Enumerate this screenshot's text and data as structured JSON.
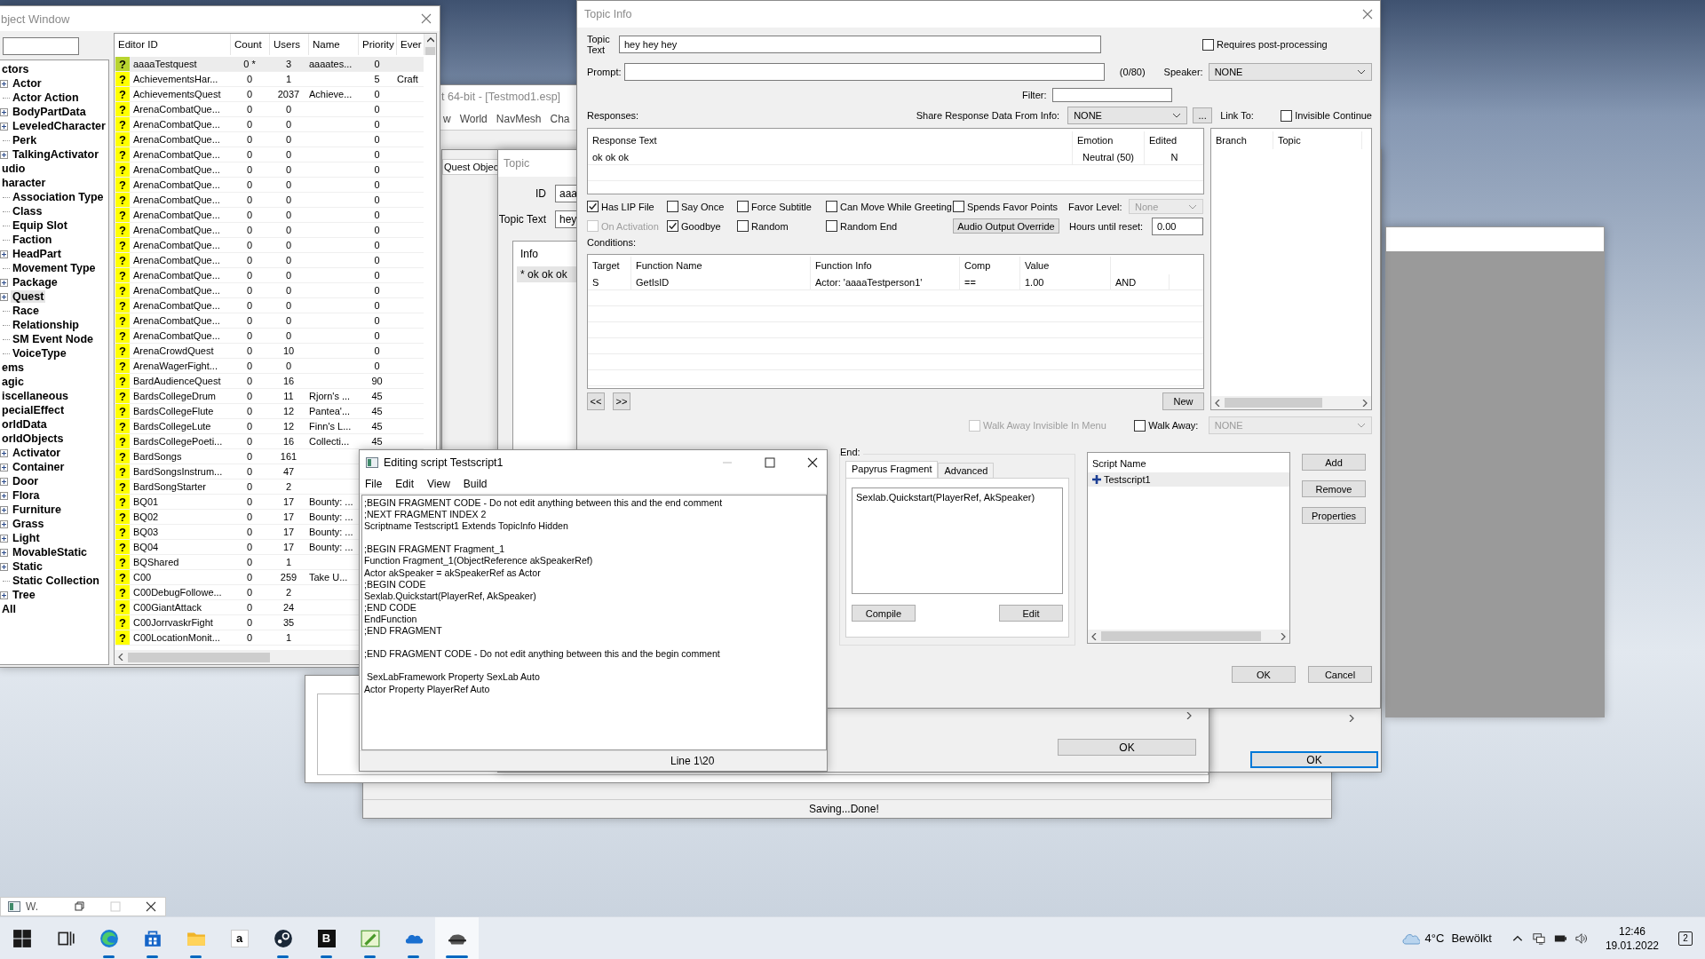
{
  "main_window": {
    "title": "t 64-bit - [Testmod1.esp]",
    "menu": [
      "w",
      "World",
      "NavMesh",
      "Cha"
    ],
    "status": "Saving...Done!"
  },
  "quest_window": {
    "tab": "Quest Objec",
    "ok": "OK"
  },
  "topic_window": {
    "title": "Topic",
    "id_label": "ID",
    "id_value": "aaa",
    "text_label": "Topic Text",
    "text_value": "hey",
    "info_header": "Info",
    "info_items": [
      {
        "text": "* ok ok ok",
        "selected": true
      }
    ],
    "ok": "OK"
  },
  "object_window": {
    "title": "bject Window",
    "tree": [
      {
        "label": "ctors",
        "selected": false,
        "children": [
          {
            "label": "Actor",
            "expander": true,
            "selected": false
          },
          {
            "label": "Actor Action",
            "expander": false,
            "selected": false
          },
          {
            "label": "BodyPartData",
            "expander": true,
            "selected": false
          },
          {
            "label": "LeveledCharacter",
            "expander": true,
            "selected": false
          },
          {
            "label": "Perk",
            "expander": false,
            "selected": false
          },
          {
            "label": "TalkingActivator",
            "expander": true,
            "selected": false
          }
        ]
      },
      {
        "label": "udio",
        "selected": false
      },
      {
        "label": "haracter",
        "selected": false,
        "children": [
          {
            "label": "Association Type",
            "expander": false,
            "selected": false
          },
          {
            "label": "Class",
            "expander": false,
            "selected": false
          },
          {
            "label": "Equip Slot",
            "expander": false,
            "selected": false
          },
          {
            "label": "Faction",
            "expander": false,
            "selected": false
          },
          {
            "label": "HeadPart",
            "expander": true,
            "selected": false
          },
          {
            "label": "Movement Type",
            "expander": false,
            "selected": false
          },
          {
            "label": "Package",
            "expander": true,
            "selected": false
          },
          {
            "label": "Quest",
            "expander": true,
            "selected": true
          },
          {
            "label": "Race",
            "expander": false,
            "selected": false
          },
          {
            "label": "Relationship",
            "expander": false,
            "selected": false
          },
          {
            "label": "SM Event Node",
            "expander": false,
            "selected": false
          },
          {
            "label": "VoiceType",
            "expander": false,
            "selected": false
          }
        ]
      },
      {
        "label": "ems",
        "selected": false
      },
      {
        "label": "agic",
        "selected": false
      },
      {
        "label": "iscellaneous",
        "selected": false
      },
      {
        "label": "pecialEffect",
        "selected": false
      },
      {
        "label": "orldData",
        "selected": false
      },
      {
        "label": "orldObjects",
        "selected": false,
        "children": [
          {
            "label": "Activator",
            "expander": true,
            "selected": false
          },
          {
            "label": "Container",
            "expander": true,
            "selected": false
          },
          {
            "label": "Door",
            "expander": true,
            "selected": false
          },
          {
            "label": "Flora",
            "expander": true,
            "selected": false
          },
          {
            "label": "Furniture",
            "expander": true,
            "selected": false
          },
          {
            "label": "Grass",
            "expander": true,
            "selected": false
          },
          {
            "label": "Light",
            "expander": true,
            "selected": false
          },
          {
            "label": "MovableStatic",
            "expander": true,
            "selected": false
          },
          {
            "label": "Static",
            "expander": true,
            "selected": false
          },
          {
            "label": "Static Collection",
            "expander": false,
            "selected": false
          },
          {
            "label": "Tree",
            "expander": true,
            "selected": false
          }
        ]
      },
      {
        "label": "All",
        "selected": false
      }
    ],
    "columns": [
      "Editor ID",
      "Count",
      "Users",
      "Name",
      "Priority",
      "Ever"
    ],
    "rows": [
      {
        "icon": "?",
        "editor_id": "aaaaTestquest",
        "count": "0 *",
        "users": "3",
        "name": "aaaates...",
        "priority": "0",
        "selected": true
      },
      {
        "icon": "?",
        "editor_id": "AchievementsHar...",
        "count": "0",
        "users": "1",
        "priority": "5",
        "ever": "Craft",
        "selected": false
      },
      {
        "icon": "?",
        "editor_id": "AchievementsQuest",
        "count": "0",
        "users": "2037",
        "name": "Achieve...",
        "priority": "0",
        "selected": false
      },
      {
        "icon": "?",
        "editor_id": "ArenaCombatQue...",
        "count": "0",
        "users": "0",
        "priority": "0",
        "selected": false
      },
      {
        "icon": "?",
        "editor_id": "ArenaCombatQue...",
        "count": "0",
        "users": "0",
        "priority": "0",
        "selected": false
      },
      {
        "icon": "?",
        "editor_id": "ArenaCombatQue...",
        "count": "0",
        "users": "0",
        "priority": "0",
        "selected": false
      },
      {
        "icon": "?",
        "editor_id": "ArenaCombatQue...",
        "count": "0",
        "users": "0",
        "priority": "0",
        "selected": false
      },
      {
        "icon": "?",
        "editor_id": "ArenaCombatQue...",
        "count": "0",
        "users": "0",
        "priority": "0",
        "selected": false
      },
      {
        "icon": "?",
        "editor_id": "ArenaCombatQue...",
        "count": "0",
        "users": "0",
        "priority": "0",
        "selected": false
      },
      {
        "icon": "?",
        "editor_id": "ArenaCombatQue...",
        "count": "0",
        "users": "0",
        "priority": "0",
        "selected": false
      },
      {
        "icon": "?",
        "editor_id": "ArenaCombatQue...",
        "count": "0",
        "users": "0",
        "priority": "0",
        "selected": false
      },
      {
        "icon": "?",
        "editor_id": "ArenaCombatQue...",
        "count": "0",
        "users": "0",
        "priority": "0",
        "selected": false
      },
      {
        "icon": "?",
        "editor_id": "ArenaCombatQue...",
        "count": "0",
        "users": "0",
        "priority": "0",
        "selected": false
      },
      {
        "icon": "?",
        "editor_id": "ArenaCombatQue...",
        "count": "0",
        "users": "0",
        "priority": "0",
        "selected": false
      },
      {
        "icon": "?",
        "editor_id": "ArenaCombatQue...",
        "count": "0",
        "users": "0",
        "priority": "0",
        "selected": false
      },
      {
        "icon": "?",
        "editor_id": "ArenaCombatQue...",
        "count": "0",
        "users": "0",
        "priority": "0",
        "selected": false
      },
      {
        "icon": "?",
        "editor_id": "ArenaCombatQue...",
        "count": "0",
        "users": "0",
        "priority": "0",
        "selected": false
      },
      {
        "icon": "?",
        "editor_id": "ArenaCombatQue...",
        "count": "0",
        "users": "0",
        "priority": "0",
        "selected": false
      },
      {
        "icon": "?",
        "editor_id": "ArenaCombatQue...",
        "count": "0",
        "users": "0",
        "priority": "0",
        "selected": false
      },
      {
        "icon": "?",
        "editor_id": "ArenaCrowdQuest",
        "count": "0",
        "users": "10",
        "priority": "0",
        "selected": false
      },
      {
        "icon": "?",
        "editor_id": "ArenaWagerFight...",
        "count": "0",
        "users": "0",
        "priority": "0",
        "selected": false
      },
      {
        "icon": "?",
        "editor_id": "BardAudienceQuest",
        "count": "0",
        "users": "16",
        "priority": "90",
        "selected": false
      },
      {
        "icon": "?",
        "editor_id": "BardsCollegeDrum",
        "count": "0",
        "users": "11",
        "name": "Rjorn's ...",
        "priority": "45",
        "selected": false
      },
      {
        "icon": "?",
        "editor_id": "BardsCollegeFlute",
        "count": "0",
        "users": "12",
        "name": "Pantea'...",
        "priority": "45",
        "selected": false
      },
      {
        "icon": "?",
        "editor_id": "BardsCollegeLute",
        "count": "0",
        "users": "12",
        "name": "Finn's L...",
        "priority": "45",
        "selected": false
      },
      {
        "icon": "?",
        "editor_id": "BardsCollegePoeti...",
        "count": "0",
        "users": "16",
        "name": "Collecti...",
        "priority": "45",
        "selected": false
      },
      {
        "icon": "?",
        "editor_id": "BardSongs",
        "count": "0",
        "users": "161",
        "selected": false
      },
      {
        "icon": "?",
        "editor_id": "BardSongsInstrum...",
        "count": "0",
        "users": "47",
        "selected": false
      },
      {
        "icon": "?",
        "editor_id": "BardSongStarter",
        "count": "0",
        "users": "2",
        "selected": false
      },
      {
        "icon": "?",
        "editor_id": "BQ01",
        "count": "0",
        "users": "17",
        "name": "Bounty: ...",
        "selected": false
      },
      {
        "icon": "?",
        "editor_id": "BQ02",
        "count": "0",
        "users": "17",
        "name": "Bounty: ...",
        "selected": false
      },
      {
        "icon": "?",
        "editor_id": "BQ03",
        "count": "0",
        "users": "17",
        "name": "Bounty: ...",
        "selected": false
      },
      {
        "icon": "?",
        "editor_id": "BQ04",
        "count": "0",
        "users": "17",
        "name": "Bounty: ...",
        "selected": false
      },
      {
        "icon": "?",
        "editor_id": "BQShared",
        "count": "0",
        "users": "1",
        "selected": false
      },
      {
        "icon": "?",
        "editor_id": "C00",
        "count": "0",
        "users": "259",
        "name": "Take U...",
        "selected": false
      },
      {
        "icon": "?",
        "editor_id": "C00DebugFollowe...",
        "count": "0",
        "users": "2",
        "selected": false
      },
      {
        "icon": "?",
        "editor_id": "C00GiantAttack",
        "count": "0",
        "users": "24",
        "selected": false
      },
      {
        "icon": "?",
        "editor_id": "C00JorrvaskrFight",
        "count": "0",
        "users": "35",
        "selected": false
      },
      {
        "icon": "?",
        "editor_id": "C00LocationMonit...",
        "count": "0",
        "users": "1",
        "selected": false
      }
    ]
  },
  "topic_info": {
    "title": "Topic Info",
    "topic_text_label": "Topic Text",
    "topic_text": "hey hey hey",
    "requires_post_processing": {
      "label": "Requires post-processing",
      "checked": false
    },
    "prompt_label": "Prompt:",
    "prompt_count": "(0/80)",
    "speaker_label": "Speaker:",
    "speaker": {
      "value": "NONE",
      "disabled": false
    },
    "filter_label": "Filter:",
    "responses_label": "Responses:",
    "share_label": "Share Response Data From Info:",
    "share_value": {
      "value": "NONE",
      "disabled": false
    },
    "more_button": "...",
    "link_to_label": "Link To:",
    "invisible_continue": {
      "label": "Invisible Continue",
      "checked": false
    },
    "response_columns": [
      "Response Text",
      "Emotion",
      "Edited"
    ],
    "response_rows": [
      [
        "ok ok ok",
        "Neutral (50)",
        "N"
      ]
    ],
    "link_columns": [
      "Branch",
      "Topic"
    ],
    "flags_row1": [
      {
        "label": "Has LIP File",
        "checked": true,
        "disabled": false
      },
      {
        "label": "Say Once",
        "checked": false,
        "disabled": false
      },
      {
        "label": "Force Subtitle",
        "checked": false,
        "disabled": false
      },
      {
        "label": "Can Move While Greeting",
        "checked": false,
        "disabled": false
      },
      {
        "label": "Spends Favor Points",
        "checked": false,
        "disabled": false
      }
    ],
    "flags_row2": [
      {
        "label": "On Activation",
        "checked": false,
        "disabled": true
      },
      {
        "label": "Goodbye",
        "checked": true,
        "disabled": false
      },
      {
        "label": "Random",
        "checked": false,
        "disabled": false
      },
      {
        "label": "Random End",
        "checked": false,
        "disabled": false
      }
    ],
    "favor_label": "Favor Level:",
    "favor": {
      "value": "None",
      "disabled": true
    },
    "audio_button": "Audio Output Override",
    "hours_label": "Hours until reset:",
    "hours_value": "0.00",
    "conditions_label": "Conditions:",
    "condition_columns": [
      "Target",
      "Function Name",
      "Function Info",
      "Comp",
      "Value"
    ],
    "condition_rows": [
      [
        "S",
        "GetIsID",
        "Actor: 'aaaaTestperson1'",
        "==",
        "1.00",
        "AND"
      ]
    ],
    "prev_button": "<<",
    "next_button": ">>",
    "new_button": "New",
    "walk_away_invisible": {
      "label": "Walk Away Invisible In Menu",
      "checked": false,
      "disabled": true
    },
    "walk_away": {
      "label": "Walk Away:",
      "checked": false,
      "disabled": false
    },
    "walk_away_value": {
      "value": "NONE",
      "disabled": true
    },
    "end_label": "End:",
    "tabs": [
      {
        "label": "Papyrus Fragment",
        "selected": true
      },
      {
        "label": "Advanced",
        "selected": false
      }
    ],
    "fragment": "Sexlab.Quickstart(PlayerRef, AkSpeaker)",
    "compile_button": "Compile",
    "edit_button": "Edit",
    "scripts_header": "Script Name",
    "scripts": [
      {
        "name": "Testscript1",
        "selected": true
      }
    ],
    "script_buttons": [
      "Add",
      "Remove",
      "Properties"
    ],
    "ok": "OK",
    "cancel": "Cancel"
  },
  "script_editor": {
    "title": "Editing script Testscript1",
    "menu": [
      "File",
      "Edit",
      "View",
      "Build"
    ],
    "code": ";BEGIN FRAGMENT CODE - Do not edit anything between this and the end comment\n;NEXT FRAGMENT INDEX 2\nScriptname Testscript1 Extends TopicInfo Hidden\n\n;BEGIN FRAGMENT Fragment_1\nFunction Fragment_1(ObjectReference akSpeakerRef)\nActor akSpeaker = akSpeakerRef as Actor\n;BEGIN CODE\nSexlab.Quickstart(PlayerRef, AkSpeaker)\n;END CODE\nEndFunction\n;END FRAGMENT\n\n;END FRAGMENT CODE - Do not edit anything between this and the begin comment\n\n SexLabFramework Property SexLab Auto\nActor Property PlayerRef Auto",
    "status": "Line 1\\20"
  },
  "minimized_window": {
    "title": "W."
  },
  "taskbar": {
    "apps": [
      {
        "kind": "start"
      },
      {
        "kind": "task-view"
      },
      {
        "kind": "browser",
        "open": true,
        "active": false
      },
      {
        "kind": "store",
        "open": true,
        "active": false
      },
      {
        "kind": "folder",
        "open": true,
        "active": false
      },
      {
        "kind": "glyph-light",
        "glyph": "a",
        "open": false,
        "active": false
      },
      {
        "kind": "steam",
        "open": true,
        "active": false
      },
      {
        "kind": "glyph-dark",
        "glyph": "B",
        "open": true,
        "active": false
      },
      {
        "kind": "paint",
        "open": true,
        "active": false
      },
      {
        "kind": "cloud",
        "open": true,
        "active": false
      },
      {
        "kind": "helmet",
        "open": true,
        "active": true
      }
    ],
    "temperature": "4°C",
    "weather": "Bewölkt",
    "time": "12:46",
    "date": "19.01.2022",
    "notifications": "2"
  }
}
